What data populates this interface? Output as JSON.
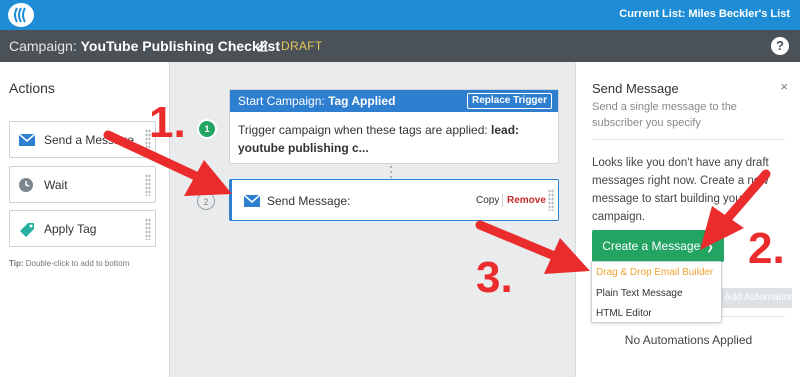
{
  "topbar": {
    "current_list": "Current List: Miles Beckler's List",
    "brand_color": "#1e8dd6"
  },
  "campaign": {
    "label": "Campaign:",
    "name": "YouTube Publishing Checklist",
    "status": "DRAFT",
    "help_label": "?"
  },
  "actions": {
    "title": "Actions",
    "items": [
      {
        "label": "Send a Message",
        "icon": "envelope-icon"
      },
      {
        "label": "Wait",
        "icon": "clock-icon"
      },
      {
        "label": "Apply Tag",
        "icon": "tag-icon"
      }
    ],
    "tip_prefix": "Tip:",
    "tip_text": "Double-click to add to bottom"
  },
  "canvas": {
    "trigger": {
      "step": "1",
      "head_prefix": "Start Campaign:",
      "head_value": "Tag Applied",
      "replace_label": "Replace Trigger",
      "body_text": "Trigger campaign when these tags are applied:",
      "body_tags": "lead: youtube publishing c..."
    },
    "send_node": {
      "step": "2",
      "label": "Send Message:",
      "copy_label": "Copy",
      "remove_label": "Remove"
    }
  },
  "panel": {
    "title": "Send Message",
    "close_label": "×",
    "subtitle": "Send a single message to the subscriber you specify",
    "message": "Looks like you don't have any draft messages right now. Create a new message to start building your campaign.",
    "create_label": "Create a Message",
    "add_automation_label": "+ Add Automation",
    "no_automations": "No Automations Applied"
  },
  "dropdown": {
    "options": [
      "Drag & Drop Email Builder",
      "Plain Text Message",
      "HTML Editor"
    ]
  },
  "annotations": {
    "one": "1.",
    "two": "2.",
    "three": "3.",
    "color": "#ea2c2c"
  }
}
